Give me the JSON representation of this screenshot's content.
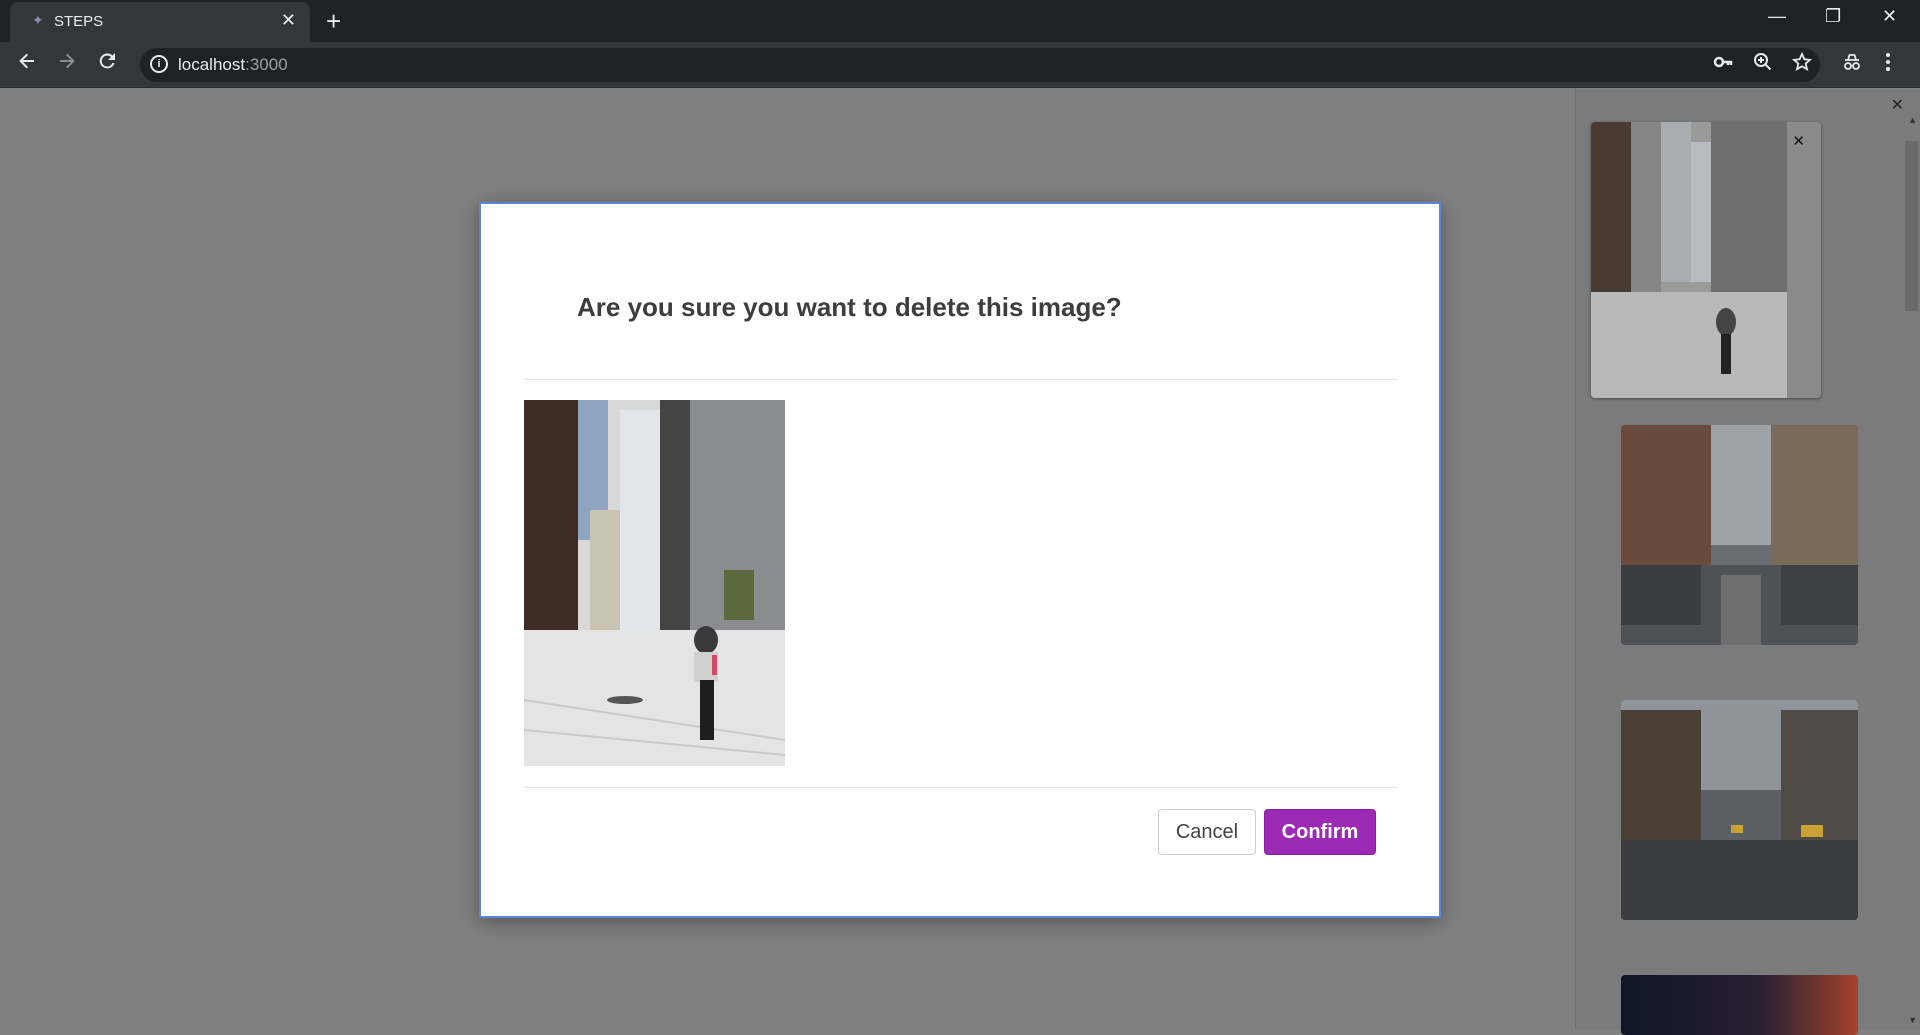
{
  "browser": {
    "tab_title": "STEPS",
    "tab_close": "✕",
    "new_tab": "+",
    "url_host": "localhost",
    "url_port": ":3000",
    "icons": {
      "back": "back-arrow-icon",
      "forward": "forward-arrow-icon",
      "reload": "reload-icon",
      "info": "info-icon",
      "key": "key-icon",
      "zoom": "zoom-icon",
      "star": "bookmark-star-icon",
      "extension": "incognito-icon",
      "menu": "kebab-menu-icon"
    },
    "window_controls": {
      "minimize": "—",
      "restore": "❐",
      "close": "✕"
    }
  },
  "modal": {
    "title": "Are you sure you want to delete this image?",
    "cancel_label": "Cancel",
    "confirm_label": "Confirm",
    "accent_color": "#9b2bb5",
    "border_color": "#5b86d6"
  },
  "sidepanel": {
    "close": "✕",
    "thumb_close": "✕",
    "thumbnails": [
      {
        "name": "street-cyclist-photo"
      },
      {
        "name": "street-parked-cars-photo"
      },
      {
        "name": "street-taxis-photo"
      },
      {
        "name": "night-sky-photo"
      }
    ]
  }
}
